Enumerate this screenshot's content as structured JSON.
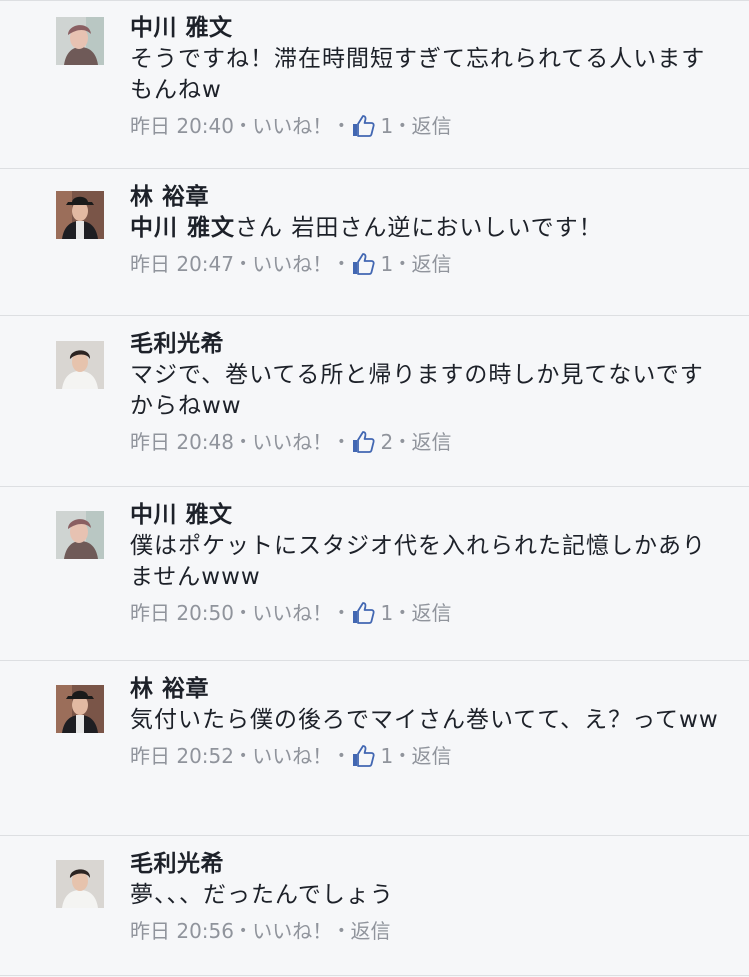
{
  "comments": [
    {
      "name": "中川 雅文",
      "mention": "",
      "text": "そうですね！滞在時間短すぎて忘れられてる人いますもんねw",
      "timestamp": "昨日 20:40",
      "like_label": "いいね！",
      "like_count": "1",
      "reply_label": "返信"
    },
    {
      "name": "林 裕章",
      "mention": "中川 雅文",
      "text": "さん 岩田さん逆においしいです！",
      "timestamp": "昨日 20:47",
      "like_label": "いいね！",
      "like_count": "1",
      "reply_label": "返信"
    },
    {
      "name": "毛利光希",
      "mention": "",
      "text": "マジで、巻いてる所と帰りますの時しか見てないですからねww",
      "timestamp": "昨日 20:48",
      "like_label": "いいね！",
      "like_count": "2",
      "reply_label": "返信"
    },
    {
      "name": "中川 雅文",
      "mention": "",
      "text": "僕はポケットにスタジオ代を入れられた記憶しかありませんwww",
      "timestamp": "昨日 20:50",
      "like_label": "いいね！",
      "like_count": "1",
      "reply_label": "返信"
    },
    {
      "name": "林 裕章",
      "mention": "",
      "text": "気付いたら僕の後ろでマイさん巻いてて、え？ってww",
      "timestamp": "昨日 20:52",
      "like_label": "いいね！",
      "like_count": "1",
      "reply_label": "返信"
    },
    {
      "name": "毛利光希",
      "mention": "",
      "text": "夢、、、だったんでしょう",
      "timestamp": "昨日 20:56",
      "like_label": "いいね！",
      "like_count": "",
      "reply_label": "返信"
    }
  ],
  "colors": {
    "background": "#f6f7f9",
    "text": "#1d2129",
    "meta": "#90949c",
    "like_icon": "#4267b2",
    "divider": "#dddfe2"
  },
  "icons": {
    "like": "thumbs-up-icon",
    "avatar": "profile-photo"
  }
}
